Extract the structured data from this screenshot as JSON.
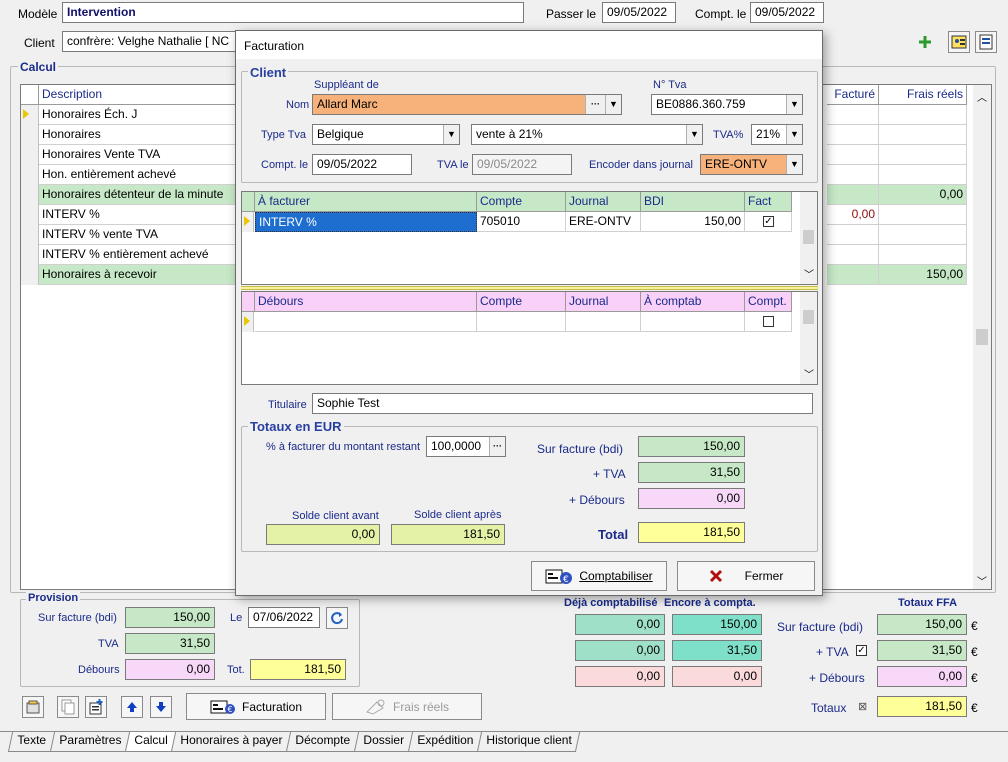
{
  "header": {
    "modele_label": "Modèle",
    "modele_value": "Intervention",
    "passer_label": "Passer le",
    "passer_value": "09/05/2022",
    "compt_label": "Compt. le",
    "compt_value": "09/05/2022",
    "client_label": "Client",
    "client_value": "confrère: Velghe Nathalie [ NC"
  },
  "calcul": {
    "title": "Calcul",
    "columns": [
      "Description",
      "Facturé",
      "Frais réels"
    ],
    "rows": [
      {
        "desc": "Honoraires Éch. J",
        "facture": "",
        "frais": "",
        "hl": false
      },
      {
        "desc": "Honoraires",
        "facture": "",
        "frais": "",
        "hl": false
      },
      {
        "desc": "Honoraires Vente TVA",
        "facture": "",
        "frais": "",
        "hl": false
      },
      {
        "desc": "Hon. entièrement achevé",
        "facture": "",
        "frais": "",
        "hl": false
      },
      {
        "desc": "Honoraires détenteur de la minute",
        "facture": "",
        "frais": "0,00",
        "hl": true
      },
      {
        "desc": "INTERV %",
        "facture": "0,00",
        "frais": "",
        "hl": false
      },
      {
        "desc": "INTERV % vente TVA",
        "facture": "",
        "frais": "",
        "hl": false
      },
      {
        "desc": "INTERV % entièrement achevé",
        "facture": "",
        "frais": "",
        "hl": false
      },
      {
        "desc": "Honoraires à recevoir",
        "facture": "",
        "frais": "150,00",
        "hl": true
      }
    ]
  },
  "provision": {
    "title": "Provision",
    "sur_facture_label": "Sur facture (bdi)",
    "sur_facture_value": "150,00",
    "le_label": "Le",
    "le_value": "07/06/2022",
    "tva_label": "TVA",
    "tva_value": "31,50",
    "debours_label": "Débours",
    "debours_value": "0,00",
    "tot_label": "Tot.",
    "tot_value": "181,50"
  },
  "summary": {
    "deja_label": "Déjà comptabilisé",
    "encore_label": "Encore à compta.",
    "totaux_ffa_label": "Totaux FFA",
    "deja": [
      "0,00",
      "0,00",
      "0,00"
    ],
    "encore": [
      "150,00",
      "31,50",
      "0,00"
    ],
    "sur_facture_label": "Sur facture (bdi)",
    "tva_label": "+ TVA",
    "debours_label": "+ Débours",
    "totaux_label": "Totaux",
    "ffa": [
      "150,00",
      "31,50",
      "0,00",
      "181,50"
    ],
    "currency": "€"
  },
  "toolbar": {
    "facturation_label": "Facturation",
    "frais_reels_label": "Frais réels"
  },
  "tabs": [
    "Texte",
    "Paramètres",
    "Calcul",
    "Honoraires à payer",
    "Décompte",
    "Dossier",
    "Expédition",
    "Historique client"
  ],
  "modal": {
    "title": "Facturation",
    "client_group": "Client",
    "suppleant_label": "Suppléant de",
    "nom_label": "Nom",
    "nom_value": "Allard Marc",
    "ntva_label": "N° Tva",
    "ntva_value": "BE0886.360.759",
    "type_tva_label": "Type Tva",
    "type_tva_value": "Belgique",
    "vente_value": "vente à 21%",
    "tva_pct_label": "TVA%",
    "tva_pct_value": "21%",
    "compt_label": "Compt. le",
    "compt_value": "09/05/2022",
    "tva_le_label": "TVA le",
    "tva_le_value": "09/05/2022",
    "journal_label": "Encoder dans journal",
    "journal_value": "ERE-ONTV",
    "grid1": {
      "columns": [
        "À facturer",
        "Compte",
        "Journal",
        "BDI",
        "Fact"
      ],
      "rows": [
        {
          "item": "INTERV %",
          "compte": "705010",
          "journal": "ERE-ONTV",
          "bdi": "150,00",
          "fact": true
        }
      ]
    },
    "grid2": {
      "columns": [
        "Débours",
        "Compte",
        "Journal",
        "À comptab",
        "Compt."
      ]
    },
    "titulaire_label": "Titulaire",
    "titulaire_value": "Sophie Test",
    "totaux_group": "Totaux en EUR",
    "pct_label": "% à facturer du montant restant",
    "pct_value": "100,0000",
    "sur_facture_label": "Sur facture (bdi)",
    "sur_facture_value": "150,00",
    "tva_label": "+ TVA",
    "tva_value": "31,50",
    "debours_label": "+ Débours",
    "debours_value": "0,00",
    "total_label": "Total",
    "total_value": "181,50",
    "solde_avant_label": "Solde client avant",
    "solde_avant_value": "0,00",
    "solde_apres_label": "Solde client après",
    "solde_apres_value": "181,50",
    "comptabiliser_label": "Comptabiliser",
    "fermer_label": "Fermer"
  },
  "colors": {
    "green_row": "#c6e8c6",
    "orange_field": "#f6b27a",
    "pink_header": "#f8d0f8",
    "yellow_total": "#ffff99"
  }
}
